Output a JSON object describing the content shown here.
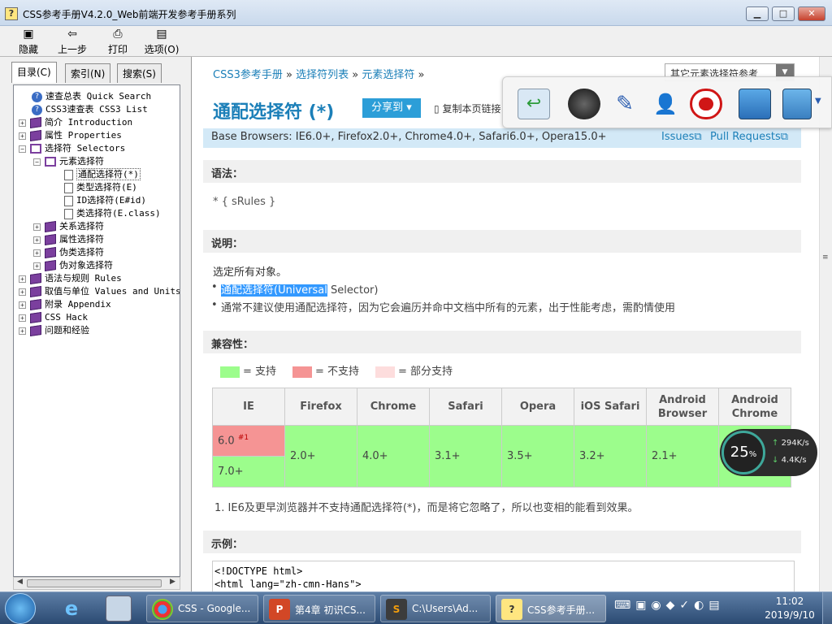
{
  "window": {
    "title": "CSS参考手册V4.2.0_Web前端开发参考手册系列",
    "min": "▁",
    "max": "□",
    "close": "✕"
  },
  "toolbar": {
    "hide": "隐藏",
    "back": "上一步",
    "print": "打印",
    "options": "选项(O)"
  },
  "tabs": [
    "目录(C)",
    "索引(N)",
    "搜索(S)"
  ],
  "tree": [
    {
      "label": "速查总表 Quick Search",
      "icon": "help-icon"
    },
    {
      "label": "CSS3速查表 CSS3 List",
      "icon": "help-icon"
    },
    {
      "label": "简介 Introduction",
      "icon": "book-icon"
    },
    {
      "label": "属性 Properties",
      "icon": "book-icon"
    },
    {
      "label": "选择符 Selectors",
      "icon": "book-open-icon"
    },
    {
      "label": "元素选择符",
      "icon": "book-open-icon"
    },
    {
      "label": "通配选择符(*)",
      "icon": "page-icon"
    },
    {
      "label": "类型选择符(E)",
      "icon": "page-icon"
    },
    {
      "label": "ID选择符(E#id)",
      "icon": "page-icon"
    },
    {
      "label": "类选择符(E.class)",
      "icon": "page-icon"
    },
    {
      "label": "关系选择符",
      "icon": "book-icon"
    },
    {
      "label": "属性选择符",
      "icon": "book-icon"
    },
    {
      "label": "伪类选择符",
      "icon": "book-icon"
    },
    {
      "label": "伪对象选择符",
      "icon": "book-icon"
    },
    {
      "label": "语法与规则 Rules",
      "icon": "book-icon"
    },
    {
      "label": "取值与单位 Values and Units",
      "icon": "book-icon"
    },
    {
      "label": "附录 Appendix",
      "icon": "book-icon"
    },
    {
      "label": "CSS Hack",
      "icon": "book-icon"
    },
    {
      "label": "问题和经验",
      "icon": "book-icon"
    }
  ],
  "content": {
    "breadcrumb": [
      "CSS3参考手册",
      "选择符列表",
      "元素选择符"
    ],
    "crumb_sep": "»",
    "other_selectors": "其它元素选择符参考",
    "title": "通配选择符 (*)",
    "share": "分享到 ▾",
    "copy_link": "复制本页链接",
    "base_browsers": "Base Browsers: IE6.0+, Firefox2.0+, Chrome4.0+, Safari6.0+, Opera15.0+",
    "issues": "Issues",
    "pull_requests": "Pull Requests",
    "syntax_head": "语法：",
    "syntax": "* { sRules }",
    "desc_head": "说明：",
    "desc": "选定所有对象。",
    "bullet1_hl": "通配选择符(Universal",
    "bullet1_rest": " Selector)",
    "bullet2": "通常不建议使用通配选择符，因为它会遍历并命中文档中所有的元素，出于性能考虑，需酌情使用",
    "compat_head": "兼容性：",
    "legend": {
      "yes": "= 支持",
      "no": "= 不支持",
      "partial": "= 部分支持",
      "yes_color": "#9cfd8c",
      "no_color": "#f59494",
      "partial_color": "#fddddd"
    },
    "compat_headers": [
      "IE",
      "Firefox",
      "Chrome",
      "Safari",
      "Opera",
      "iOS Safari",
      "Android Browser",
      "Android Chrome"
    ],
    "ie_rows": [
      "6.0",
      "7.0+"
    ],
    "ie_note_ref": "#1",
    "compat_values": [
      "2.0+",
      "4.0+",
      "3.1+",
      "3.5+",
      "3.2+",
      "2.1+"
    ],
    "note": "1.   IE6及更早浏览器并不支持通配选择符(*)，而是将它忽略了，所以也变相的能看到效果。",
    "example_head": "示例：",
    "code_line1": "<!DOCTYPE html>",
    "code_line2": "<html lang=\"zh-cmn-Hans\">"
  },
  "meter": {
    "percent": "25",
    "unit": "%",
    "up": "294K/s",
    "down": "4.4K/s"
  },
  "taskbar": {
    "tasks": [
      "CSS - Google...",
      "第4章 初识CS...",
      "C:\\Users\\Ad...",
      "CSS参考手册..."
    ],
    "time": "11:02",
    "date": "2019/9/10"
  }
}
